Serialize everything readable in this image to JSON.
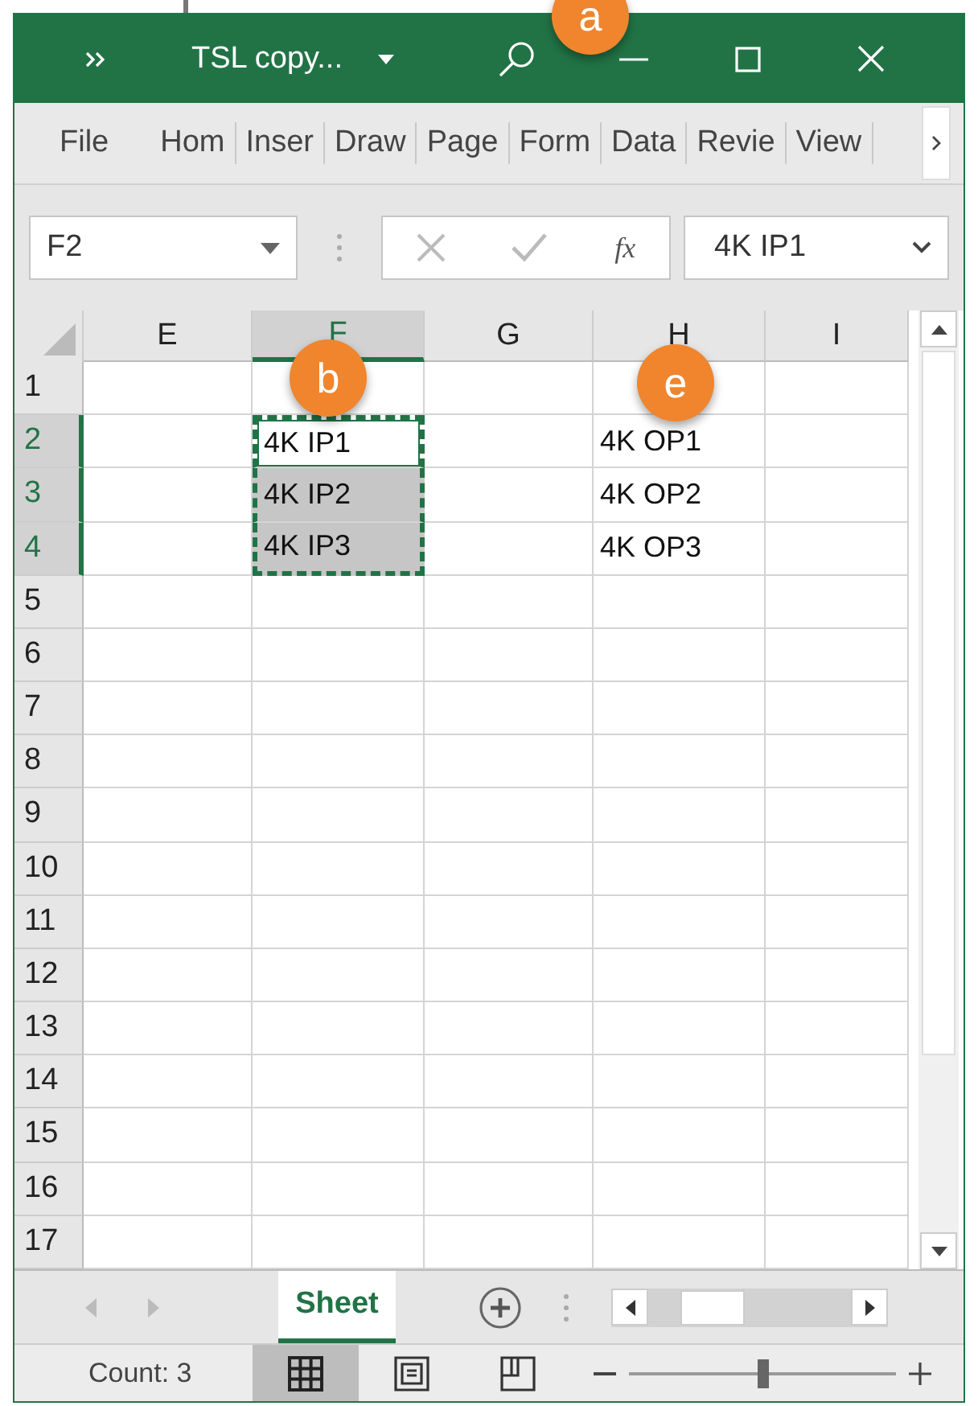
{
  "window": {
    "title": "TSL copy..."
  },
  "ribbon_tabs": [
    {
      "label": "File",
      "selected": false
    },
    {
      "label": "Hom",
      "selected": false
    },
    {
      "label": "Inser",
      "selected": false
    },
    {
      "label": "Draw",
      "selected": false
    },
    {
      "label": "Page",
      "selected": false
    },
    {
      "label": "Form",
      "selected": false
    },
    {
      "label": "Data",
      "selected": false
    },
    {
      "label": "Revie",
      "selected": false
    },
    {
      "label": "View",
      "selected": false
    }
  ],
  "formula_bar": {
    "name_box": "F2",
    "function_label": "fx",
    "value": "4K IP1"
  },
  "columns": [
    {
      "label": "E",
      "selected": false
    },
    {
      "label": "F",
      "selected": true
    },
    {
      "label": "G",
      "selected": false
    },
    {
      "label": "H",
      "selected": false
    },
    {
      "label": "I",
      "selected": false
    }
  ],
  "rows": [
    {
      "header": "1",
      "selected": false
    },
    {
      "header": "2",
      "selected": true,
      "cells": [
        {
          "selected": false,
          "active": false
        },
        {
          "text": "4K IP1",
          "selected": true,
          "active": true
        },
        {
          "selected": false,
          "active": false
        },
        {
          "text": "4K OP1",
          "selected": false,
          "active": false
        },
        {
          "selected": false,
          "active": false
        }
      ]
    },
    {
      "header": "3",
      "selected": true,
      "cells": [
        {
          "selected": false,
          "active": false
        },
        {
          "text": "4K IP2",
          "selected": true,
          "active": false
        },
        {
          "selected": false,
          "active": false
        },
        {
          "text": "4K OP2",
          "selected": false,
          "active": false
        },
        {
          "selected": false,
          "active": false
        }
      ]
    },
    {
      "header": "4",
      "selected": true,
      "cells": [
        {
          "selected": false,
          "active": false
        },
        {
          "text": "4K IP3",
          "selected": true,
          "active": false
        },
        {
          "selected": false,
          "active": false
        },
        {
          "text": "4K OP3",
          "selected": false,
          "active": false
        },
        {
          "selected": false,
          "active": false
        }
      ]
    },
    {
      "header": "5",
      "selected": false
    },
    {
      "header": "6",
      "selected": false
    },
    {
      "header": "7",
      "selected": false
    },
    {
      "header": "8",
      "selected": false
    },
    {
      "header": "9",
      "selected": false
    },
    {
      "header": "10",
      "selected": false
    },
    {
      "header": "11",
      "selected": false
    },
    {
      "header": "12",
      "selected": false
    },
    {
      "header": "13",
      "selected": false
    },
    {
      "header": "14",
      "selected": false
    },
    {
      "header": "15",
      "selected": false
    },
    {
      "header": "16",
      "selected": false
    },
    {
      "header": "17",
      "selected": false
    }
  ],
  "sheet_tabs": [
    {
      "label": "Sheet",
      "selected": true
    }
  ],
  "status_bar": {
    "summary": "Count: 3",
    "views": [
      {
        "kind": "normal",
        "selected": true
      },
      {
        "kind": "page_layout",
        "selected": false
      },
      {
        "kind": "page_break",
        "selected": false
      }
    ],
    "zoom": {
      "level": 0.5
    }
  },
  "callouts": [
    {
      "label": "a"
    },
    {
      "label": "b"
    },
    {
      "label": "e"
    }
  ]
}
